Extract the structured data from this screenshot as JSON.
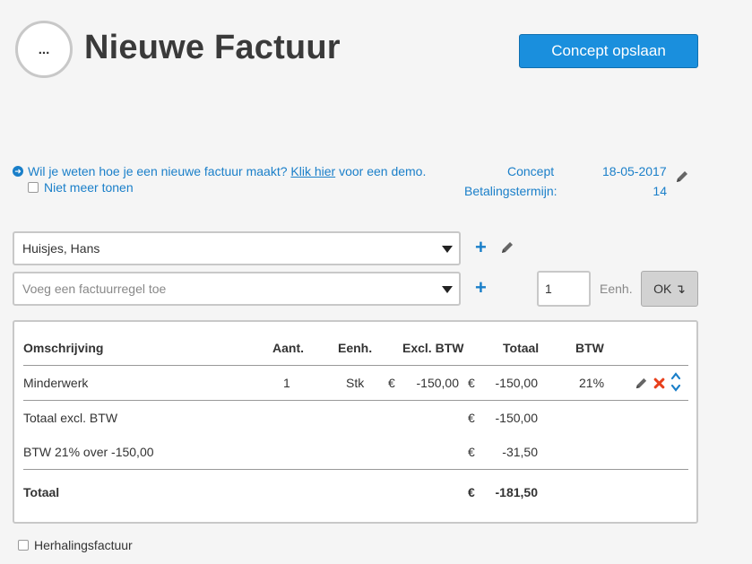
{
  "header": {
    "avatar_text": "...",
    "title": "Nieuwe Factuur",
    "save_label": "Concept opslaan"
  },
  "help": {
    "text_before": "Wil je weten hoe je een nieuwe factuur maakt?",
    "link": "Klik hier",
    "text_after": "voor een demo.",
    "dont_show": "Niet meer tonen"
  },
  "meta": {
    "status_label": "Concept",
    "date": "18-05-2017",
    "term_label": "Betalingstermijn:",
    "term_value": "14"
  },
  "form": {
    "customer": "Huisjes, Hans",
    "line_placeholder": "Voeg een factuurregel toe",
    "plus": "+",
    "quantity": "1",
    "unit_label": "Eenh.",
    "ok_label": "OK ↴"
  },
  "table": {
    "headers": {
      "description": "Omschrijving",
      "quantity": "Aant.",
      "unit": "Eenh.",
      "excl": "Excl. BTW",
      "total": "Totaal",
      "vat": "BTW"
    },
    "rows": [
      {
        "description": "Minderwerk",
        "quantity": "1",
        "unit": "Stk",
        "excl_currency": "€",
        "excl_amount": "-150,00",
        "total_currency": "€",
        "total_amount": "-150,00",
        "vat": "21%"
      }
    ],
    "summary": [
      {
        "label": "Totaal excl. BTW",
        "currency": "€",
        "amount": "-150,00"
      },
      {
        "label": "BTW 21% over -150,00",
        "currency": "€",
        "amount": "-31,50"
      }
    ],
    "grand_total": {
      "label": "Totaal",
      "currency": "€",
      "amount": "-181,50"
    }
  },
  "footer": {
    "repeat_label": "Herhalingsfactuur"
  }
}
